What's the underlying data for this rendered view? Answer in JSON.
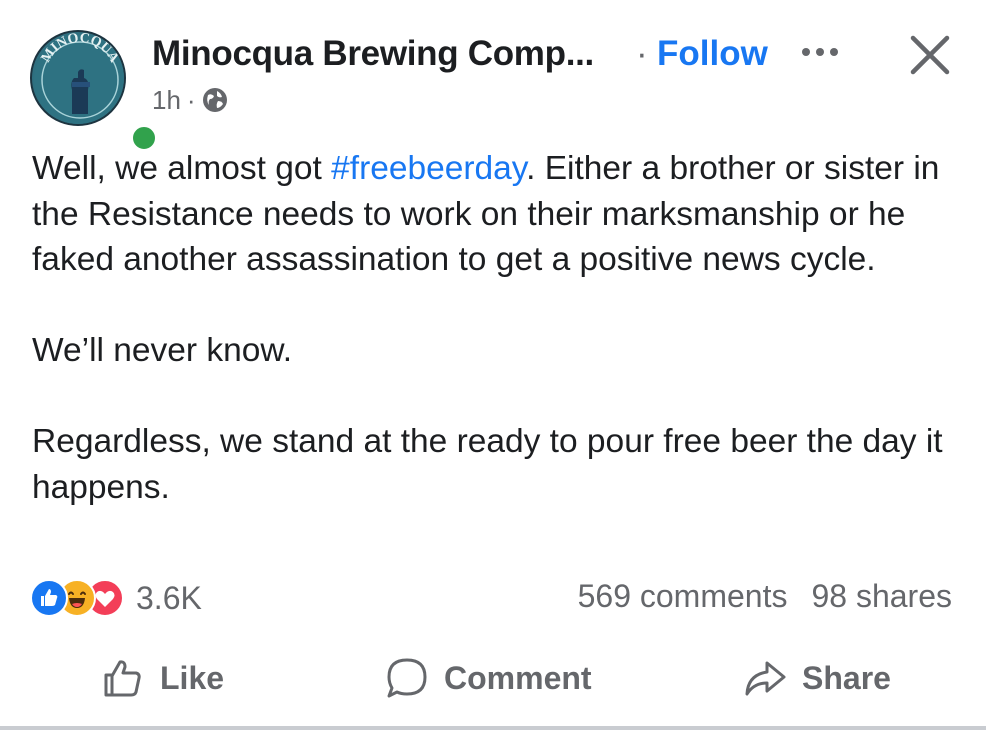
{
  "header": {
    "page_name": "Minocqua Brewing Comp...",
    "separator": "·",
    "follow_label": "Follow",
    "time": "1h",
    "time_separator": "·",
    "avatar_text": "MINOCQUA"
  },
  "post": {
    "paragraph1_before": "Well, we almost got ",
    "hashtag": "#freebeerday",
    "paragraph1_after": ".  Either a brother or sister in the Resistance needs to work on their marksmanship or he faked another assassination to get a positive news cycle.",
    "paragraph2": "We’ll never know.",
    "paragraph3": "Regardless, we stand at the ready to pour free beer the day it happens."
  },
  "engagement": {
    "reaction_count": "3.6K",
    "comments": "569 comments",
    "shares": "98 shares"
  },
  "actions": {
    "like": "Like",
    "comment": "Comment",
    "share": "Share"
  },
  "colors": {
    "accent": "#1877f2",
    "text": "#1c1e21",
    "muted": "#65676b",
    "online": "#31a24c"
  },
  "icons": [
    "more-options-icon",
    "close-icon",
    "globe-icon",
    "like-reaction-icon",
    "haha-reaction-icon",
    "love-reaction-icon",
    "thumbs-up-icon",
    "comment-bubble-icon",
    "share-arrow-icon"
  ]
}
